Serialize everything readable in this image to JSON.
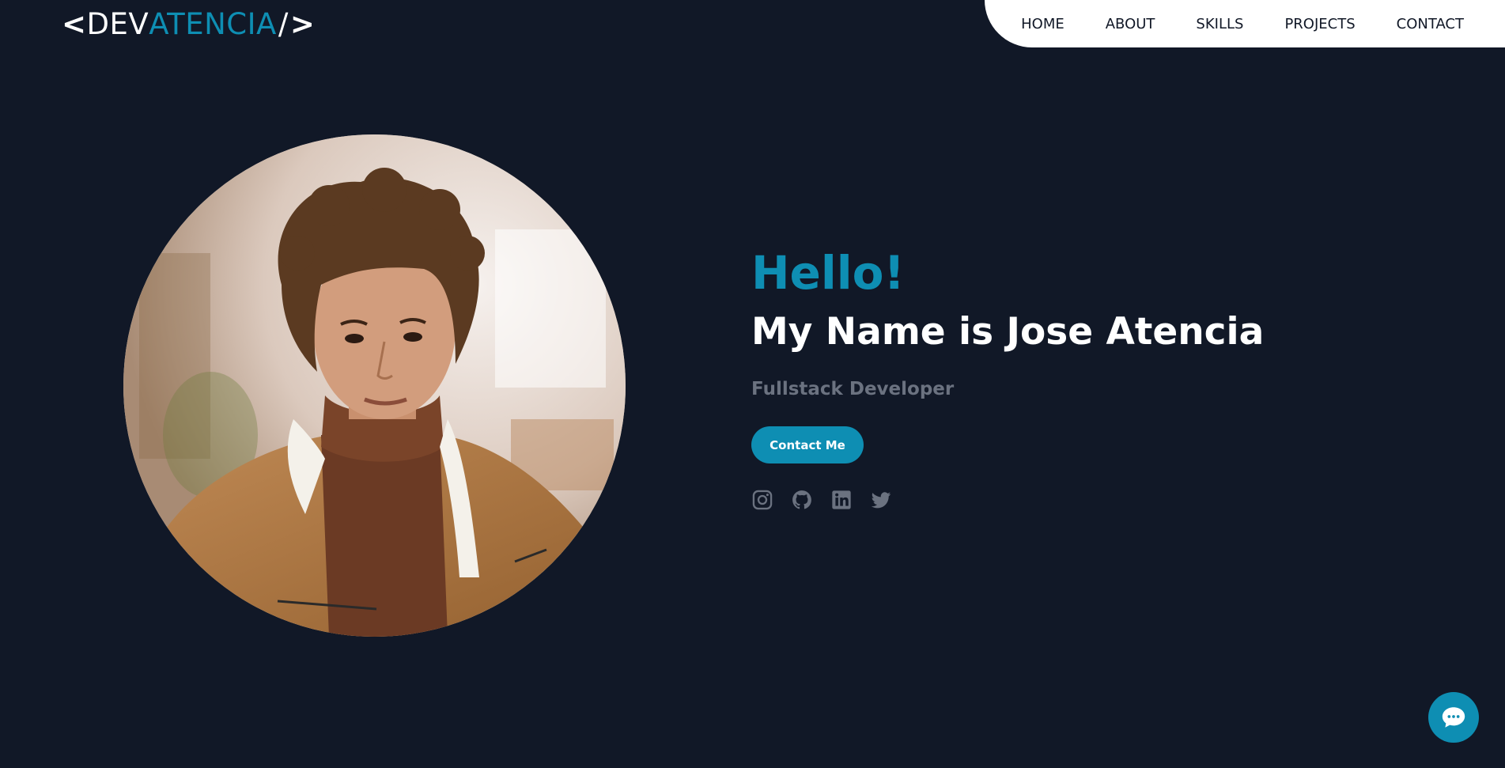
{
  "logo": {
    "open_bracket": "<",
    "part1": "DEV",
    "part2": "ATENCIA",
    "slash": "/",
    "close_bracket": ">"
  },
  "nav": {
    "items": [
      {
        "label": "HOME"
      },
      {
        "label": "ABOUT"
      },
      {
        "label": "SKILLS"
      },
      {
        "label": "PROJECTS"
      },
      {
        "label": "CONTACT"
      }
    ]
  },
  "hero": {
    "greeting": "Hello!",
    "name": "My Name is Jose Atencia",
    "role": "Fullstack Developer",
    "cta_label": "Contact Me"
  },
  "socials": [
    {
      "icon": "instagram-icon"
    },
    {
      "icon": "github-icon"
    },
    {
      "icon": "linkedin-icon"
    },
    {
      "icon": "twitter-icon"
    }
  ],
  "colors": {
    "background": "#111827",
    "accent": "#0e8eb3",
    "muted": "#6b7280",
    "nav_bg": "#ffffff"
  }
}
